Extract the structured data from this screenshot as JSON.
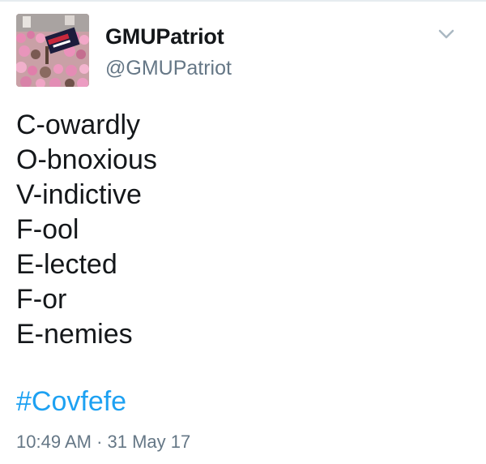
{
  "tweet": {
    "author": {
      "display_name": "GMUPatriot",
      "handle": "@GMUPatriot",
      "avatar_icon": "crowd-photo-avatar"
    },
    "menu_icon": "chevron-down-icon",
    "lines": [
      "C-owardly",
      "O-bnoxious",
      "V-indictive",
      "F-ool",
      "E-lected",
      "F-or",
      "E-nemies"
    ],
    "hashtag": "#Covfefe",
    "time": "10:49 AM",
    "separator": "·",
    "date": "31 May 17",
    "timestamp": "10:49 AM · 31 May 17"
  },
  "colors": {
    "text": "#14171a",
    "secondary": "#657786",
    "link": "#1da1f2",
    "divider": "#e6ecf0"
  }
}
